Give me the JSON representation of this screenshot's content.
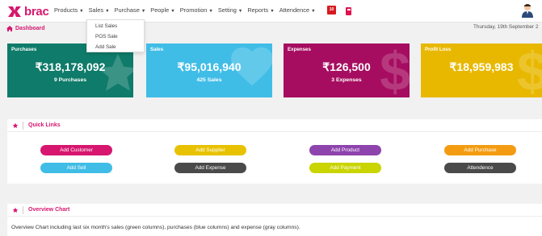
{
  "brand": {
    "name": "brac",
    "color": "#d6166f"
  },
  "nav": {
    "items": [
      {
        "label": "Products",
        "caret": "▼"
      },
      {
        "label": "Sales",
        "caret": "▼"
      },
      {
        "label": "Purchase",
        "caret": "▼"
      },
      {
        "label": "People",
        "caret": "▼"
      },
      {
        "label": "Promotion",
        "caret": "▼"
      },
      {
        "label": "Setting",
        "caret": "▼"
      },
      {
        "label": "Reports",
        "caret": "▼"
      },
      {
        "label": "Attendence",
        "caret": "▼"
      }
    ],
    "notification_count": "10",
    "icons": [
      "notification-badge-icon",
      "calculator-icon",
      "user-avatar-icon"
    ]
  },
  "sales_dropdown": {
    "items": [
      "List Sales",
      "POS Sale",
      "Add Sale"
    ]
  },
  "breadcrumb": {
    "label": "Dashboard",
    "icon": "home-icon"
  },
  "date_text": "Thursday, 19th September 2",
  "cards": [
    {
      "label": "Purchases",
      "value": "₹318,178,092",
      "sub": "9 Purchases",
      "color": "#0f7b6a",
      "icon": "star-icon"
    },
    {
      "label": "Sales",
      "value": "₹95,016,940",
      "sub": "425 Sales",
      "color": "#40bde6",
      "icon": "heart-icon"
    },
    {
      "label": "Expenses",
      "value": "₹126,500",
      "sub": "3 Expenses",
      "color": "#a60d60",
      "icon": "dollar-icon"
    },
    {
      "label": "Profit Loss",
      "value": "₹18,959,983",
      "sub": "",
      "color": "#e8b800",
      "icon": "dollar-icon"
    }
  ],
  "quick_links": {
    "title": "Quick Links",
    "buttons": [
      {
        "label": "Add Customer",
        "color": "#d6166f"
      },
      {
        "label": "Add Supplier",
        "color": "#e8c200"
      },
      {
        "label": "Add Product",
        "color": "#8e44ad"
      },
      {
        "label": "Add Purchase",
        "color": "#f39c12"
      },
      {
        "label": "Add Sell",
        "color": "#40bde6"
      },
      {
        "label": "Add Expense",
        "color": "#4a4a4a"
      },
      {
        "label": "Add Payment",
        "color": "#c9d400"
      },
      {
        "label": "Attendence",
        "color": "#4a4a4a"
      }
    ]
  },
  "overview": {
    "title": "Overview Chart",
    "text": "Overview Chart including last six month's sales (green columns), purchases (blue columns) and expense (gray columns)."
  }
}
